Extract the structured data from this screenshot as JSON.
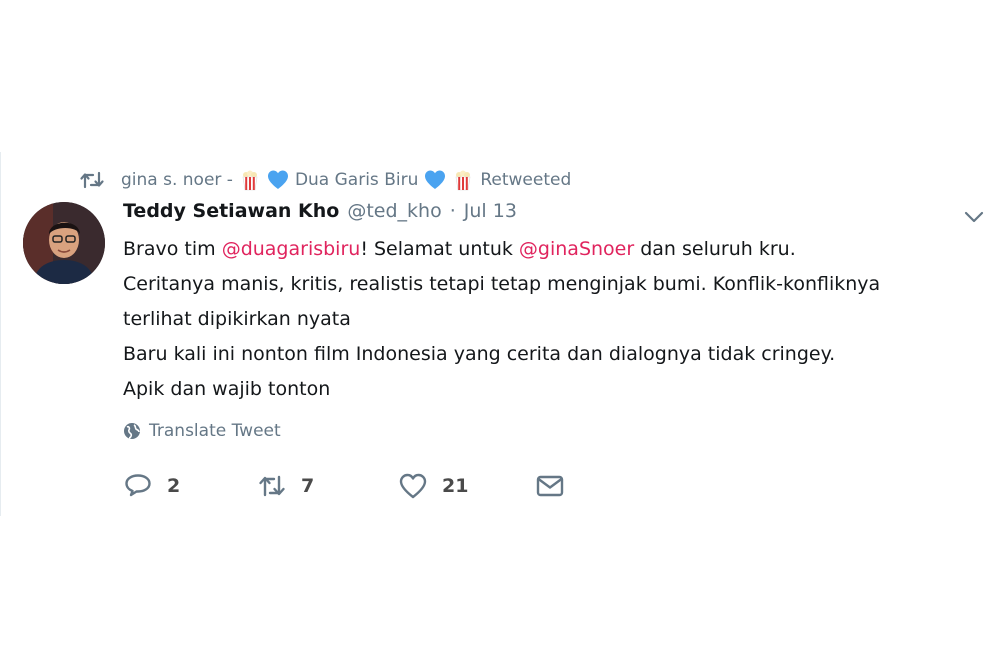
{
  "retweet_context": {
    "retweeter_name_part1": "gina s. noer -",
    "retweeter_name_part2": "Dua Garis Biru",
    "retweeted_label": "Retweeted",
    "heart_color": "#4aa3f0"
  },
  "tweet": {
    "fullname": "Teddy Setiawan Kho",
    "username": "@ted_kho",
    "dot": "·",
    "timestamp": "Jul 13",
    "lines": [
      {
        "before": "Bravo tim ",
        "mention1": "@duagarisbiru",
        "middle": "! Selamat untuk ",
        "mention2": "@ginaSnoer",
        "after": " dan seluruh kru."
      },
      "Ceritanya manis, kritis, realistis tetapi tetap menginjak bumi. Konflik-konfliknya",
      "terlihat dipikirkan nyata",
      "Baru kali ini nonton film Indonesia yang cerita dan dialognya tidak cringey.",
      "Apik dan wajib tonton"
    ],
    "mention_color": "#e0245e"
  },
  "translate": {
    "label": "Translate Tweet",
    "icon": "globe-icon"
  },
  "actions": {
    "reply_count": "2",
    "retweet_count": "7",
    "like_count": "21"
  },
  "colors": {
    "secondary_text": "#657786",
    "primary_text": "#14171a"
  }
}
